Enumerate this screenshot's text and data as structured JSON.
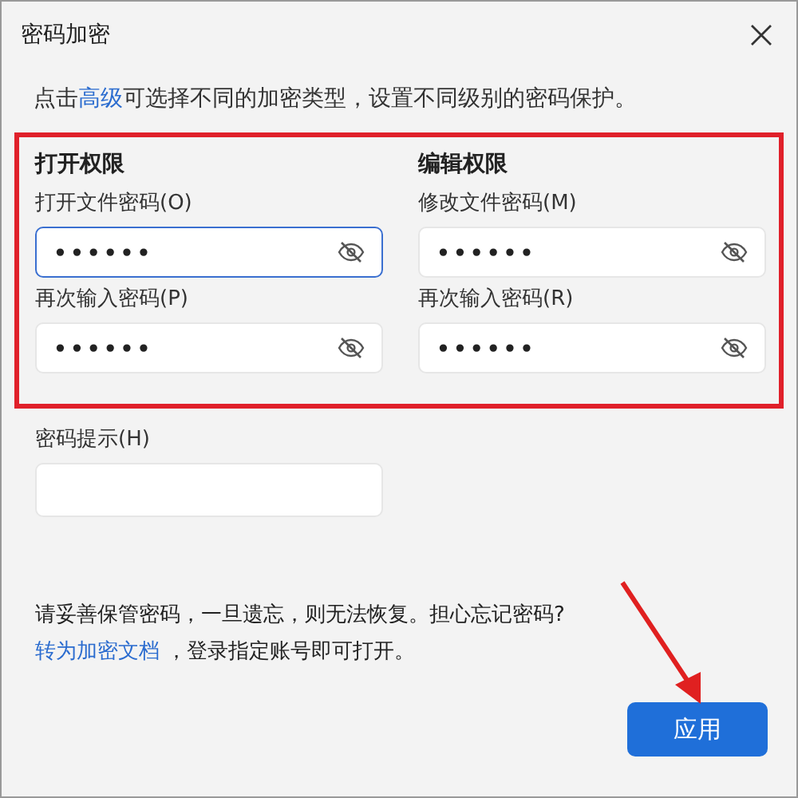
{
  "window": {
    "title": "密码加密"
  },
  "intro": {
    "before": "点击",
    "link": "高级",
    "after": "可选择不同的加密类型，设置不同级别的密码保护。"
  },
  "sections": [
    {
      "heading": "打开权限",
      "fields": [
        {
          "label": "打开文件密码(O)",
          "value": "••••••",
          "focused": true
        },
        {
          "label": "再次输入密码(P)",
          "value": "••••••",
          "focused": false
        }
      ]
    },
    {
      "heading": "编辑权限",
      "fields": [
        {
          "label": "修改文件密码(M)",
          "value": "••••••",
          "focused": false
        },
        {
          "label": "再次输入密码(R)",
          "value": "••••••",
          "focused": false
        }
      ]
    }
  ],
  "hint": {
    "label": "密码提示(H)"
  },
  "notice": {
    "text": "请妥善保管密码，一旦遗忘，则无法恢复。担心忘记密码?",
    "link": "转为加密文档",
    "after": " ，登录指定账号即可打开。"
  },
  "buttons": [
    {
      "label": "应用"
    }
  ]
}
